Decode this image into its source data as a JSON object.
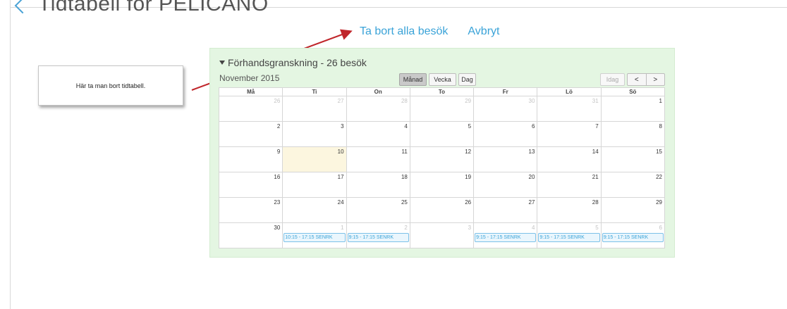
{
  "header": {
    "title": "Tidtabell för PELICANO"
  },
  "actions": {
    "remove_all": "Ta bort alla besök",
    "cancel": "Avbryt"
  },
  "callout": {
    "text": "Här ta man bort tidtabell."
  },
  "preview": {
    "title": "Förhandsgranskning - 26 besök",
    "month": "November 2015"
  },
  "toolbar": {
    "month": "Månad",
    "week": "Vecka",
    "day": "Dag",
    "today": "Idag",
    "prev": "<",
    "next": ">"
  },
  "colors": {
    "accent": "#3aa3d8",
    "panel_bg": "#e4f6e2",
    "today_bg": "#fcf6df",
    "arrow": "#c0262b"
  },
  "weekdays": [
    "Må",
    "Ti",
    "On",
    "To",
    "Fr",
    "Lö",
    "Sö"
  ],
  "weeks": [
    [
      "26",
      "27",
      "28",
      "29",
      "30",
      "31",
      "1"
    ],
    [
      "2",
      "3",
      "4",
      "5",
      "6",
      "7",
      "8"
    ],
    [
      "9",
      "10",
      "11",
      "12",
      "13",
      "14",
      "15"
    ],
    [
      "16",
      "17",
      "18",
      "19",
      "20",
      "21",
      "22"
    ],
    [
      "23",
      "24",
      "25",
      "26",
      "27",
      "28",
      "29"
    ],
    [
      "30",
      "1",
      "2",
      "3",
      "4",
      "5",
      "6"
    ]
  ],
  "events": {
    "ti": "10:15 - 17:15 SENRK",
    "on": "9:15 - 17:15 SENRK",
    "fr": "9:15 - 17:15 SENRK",
    "lo": "9:15 - 17:15 SENRK",
    "so": "9:15 - 17:15 SENRK"
  }
}
